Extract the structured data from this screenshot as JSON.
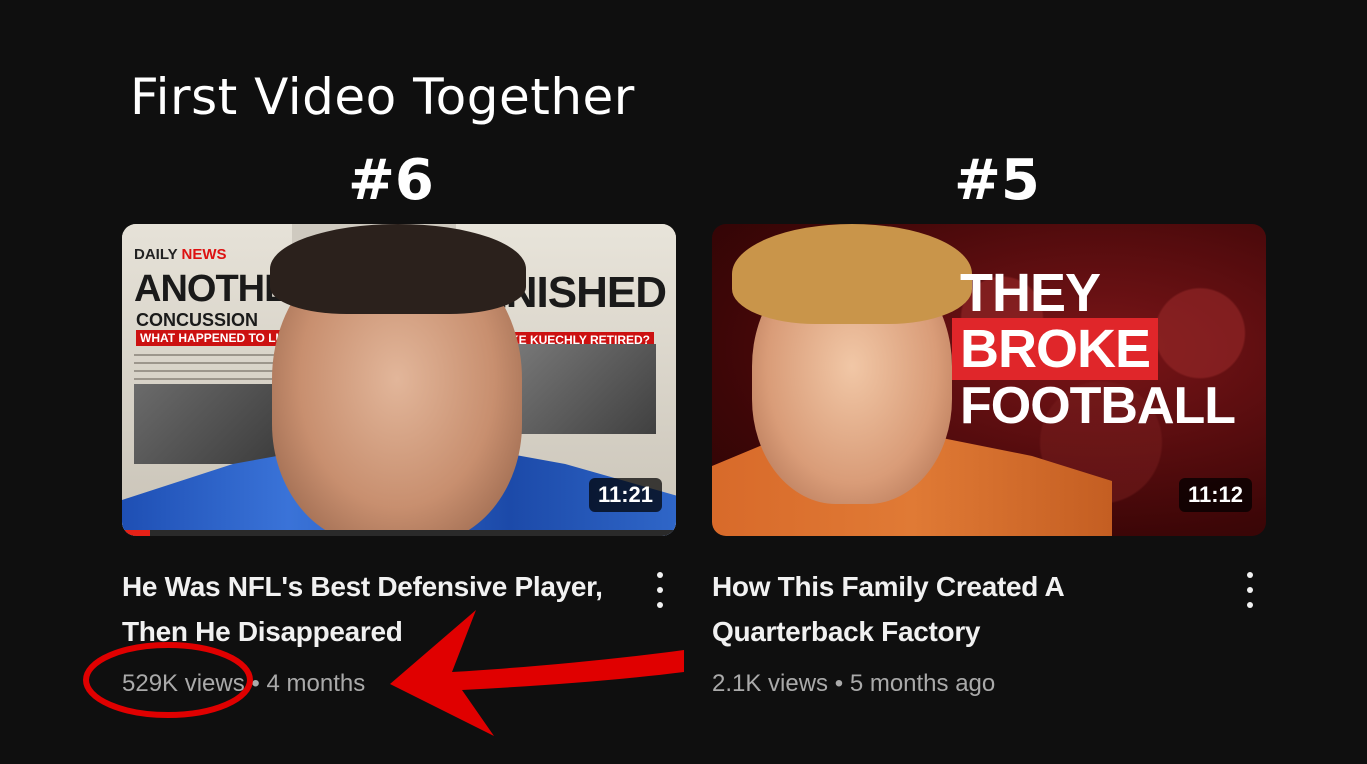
{
  "annotation": {
    "title": "First Video Together",
    "accent_color": "#e00000"
  },
  "videos": [
    {
      "rank": "#6",
      "duration": "11:21",
      "title": "He Was NFL's Best Defensive Player, Then He Disappeared",
      "views": "529K views",
      "separator": "•",
      "age": "4 months",
      "watched_fraction": 0.05,
      "thumbnail_text": {
        "paper": "DAILY",
        "paper_accent": "NEWS",
        "headline_left": "ANOTHER",
        "sub_left": "CONCUSSION",
        "tag_left": "WHAT HAPPENED TO LUKE",
        "headline_right": "VANISHED",
        "tag_right": "WHY LUKE KUECHLY RETIRED?",
        "question": "?"
      },
      "menu_icon": "kebab-menu-icon"
    },
    {
      "rank": "#5",
      "duration": "11:12",
      "title": "How This Family Created A Quarterback Factory",
      "views": "2.1K views",
      "separator": "•",
      "age": "5 months ago",
      "thumbnail_text": {
        "line1": "THEY",
        "line2": "BROKE",
        "line3": "FOOTBALL"
      },
      "menu_icon": "kebab-menu-icon"
    }
  ]
}
